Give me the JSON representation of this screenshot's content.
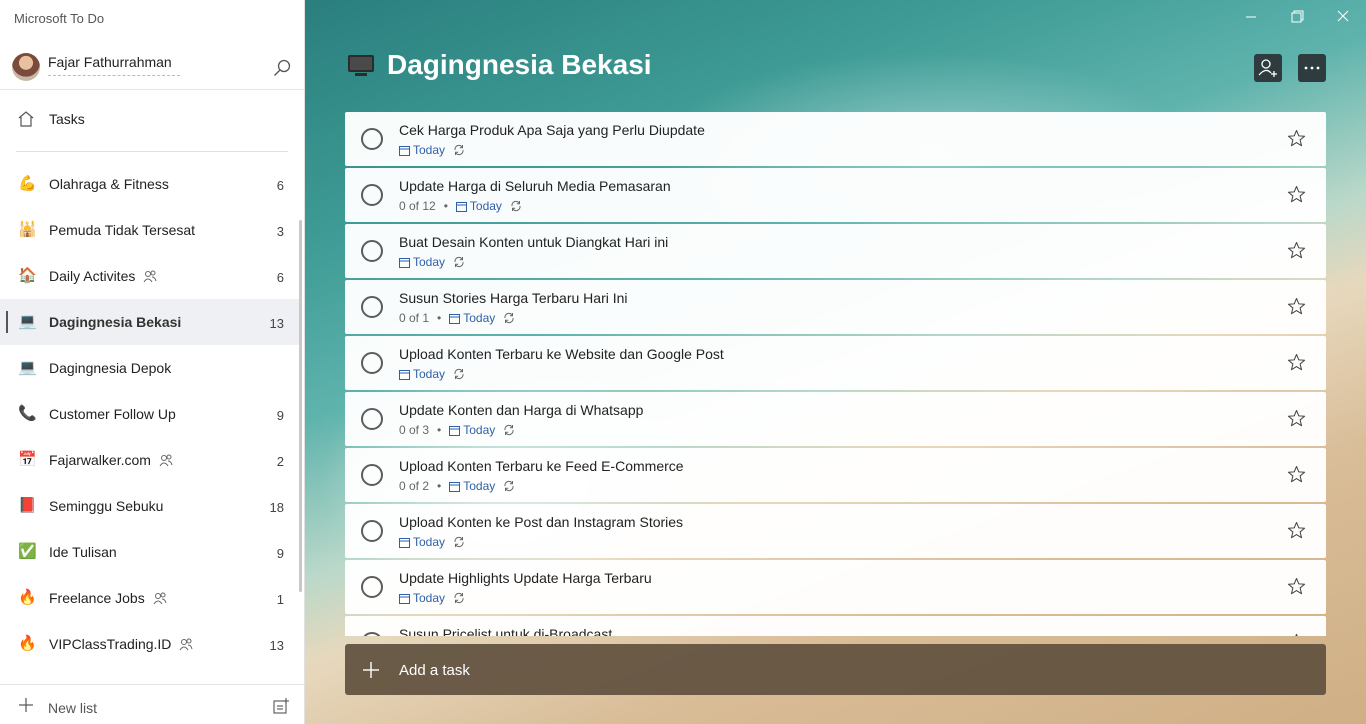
{
  "app": {
    "title": "Microsoft To Do"
  },
  "user": {
    "name": "Fajar Fathurrahman"
  },
  "nav": {
    "tasks_label": "Tasks"
  },
  "lists": [
    {
      "emoji": "💪",
      "label": "Olahraga & Fitness",
      "count": "6",
      "shared": false,
      "active": false
    },
    {
      "emoji": "🕌",
      "label": "Pemuda Tidak Tersesat",
      "count": "3",
      "shared": false,
      "active": false
    },
    {
      "emoji": "🏠",
      "label": "Daily Activites",
      "count": "6",
      "shared": true,
      "active": false
    },
    {
      "emoji": "💻",
      "label": "Dagingnesia Bekasi",
      "count": "13",
      "shared": false,
      "active": true
    },
    {
      "emoji": "💻",
      "label": "Dagingnesia Depok",
      "count": "",
      "shared": false,
      "active": false
    },
    {
      "emoji": "📞",
      "label": "Customer Follow Up",
      "count": "9",
      "shared": false,
      "active": false
    },
    {
      "emoji": "📅",
      "label": "Fajarwalker.com",
      "count": "2",
      "shared": true,
      "active": false
    },
    {
      "emoji": "📕",
      "label": "Seminggu Sebuku",
      "count": "18",
      "shared": false,
      "active": false
    },
    {
      "emoji": "✅",
      "label": "Ide Tulisan",
      "count": "9",
      "shared": false,
      "active": false
    },
    {
      "emoji": "🔥",
      "label": "Freelance Jobs",
      "count": "1",
      "shared": true,
      "active": false
    },
    {
      "emoji": "🔥",
      "label": "VIPClassTrading.ID",
      "count": "13",
      "shared": true,
      "active": false
    }
  ],
  "footer": {
    "new_list_label": "New list"
  },
  "main": {
    "title": "Dagingnesia Bekasi",
    "tasks": [
      {
        "title": "Cek Harga Produk Apa Saja yang Perlu Diupdate",
        "steps": "",
        "due": "Today"
      },
      {
        "title": "Update Harga di Seluruh Media Pemasaran",
        "steps": "0 of 12",
        "due": "Today"
      },
      {
        "title": "Buat Desain Konten untuk Diangkat Hari ini",
        "steps": "",
        "due": "Today"
      },
      {
        "title": "Susun Stories Harga Terbaru Hari Ini",
        "steps": "0 of 1",
        "due": "Today"
      },
      {
        "title": "Upload Konten Terbaru ke Website dan Google Post",
        "steps": "",
        "due": "Today"
      },
      {
        "title": "Update Konten dan Harga di Whatsapp",
        "steps": "0 of 3",
        "due": "Today"
      },
      {
        "title": "Upload Konten Terbaru ke Feed E-Commerce",
        "steps": "0 of 2",
        "due": "Today"
      },
      {
        "title": "Upload Konten ke Post dan Instagram Stories",
        "steps": "",
        "due": "Today"
      },
      {
        "title": "Update Highlights Update Harga Terbaru",
        "steps": "",
        "due": "Today"
      },
      {
        "title": "Susun Pricelist untuk di-Broadcast",
        "steps": "",
        "due": ""
      }
    ],
    "add_task_label": "Add a task"
  },
  "colors": {
    "accent": "#2f5fa8",
    "add_task_bg": "#5f503e"
  }
}
